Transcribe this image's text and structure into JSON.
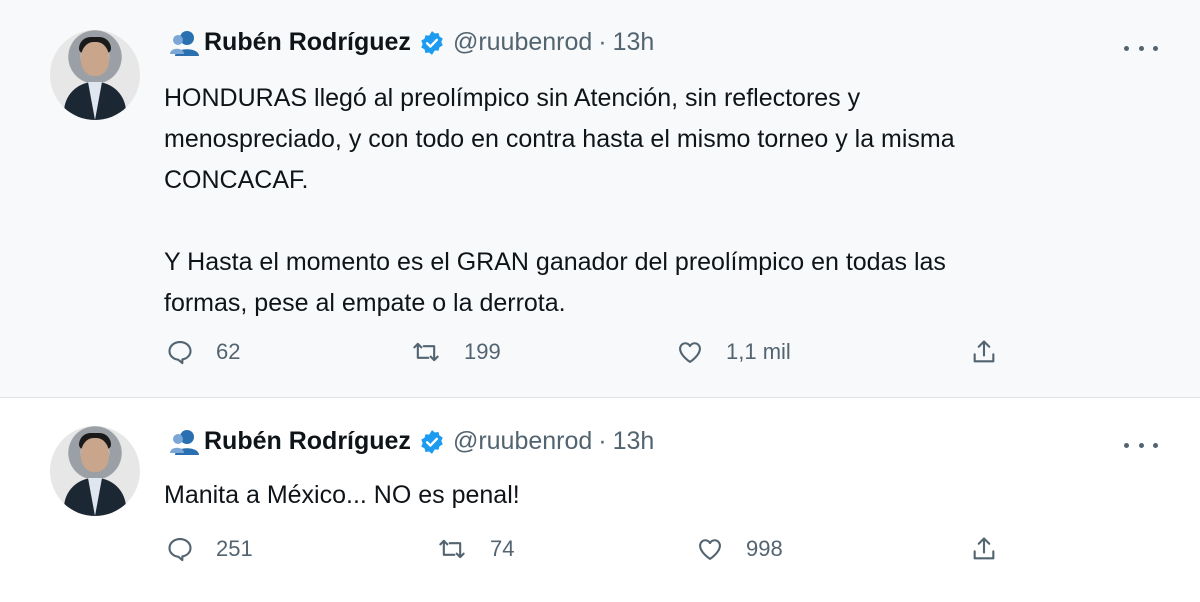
{
  "tweets": [
    {
      "author": {
        "name": "Rubén Rodríguez",
        "handle": "@ruubenrod",
        "separator": "·",
        "time": "13h"
      },
      "text_lines": [
        "HONDURAS llegó al preolímpico sin Atención, sin reflectores y",
        "menospreciado, y con todo en contra hasta el mismo torneo y la misma",
        "CONCACAF.",
        "",
        "Y Hasta el momento es el GRAN ganador del preolímpico en todas las",
        "formas, pese al empate o la derrota."
      ],
      "replies": "62",
      "retweets": "199",
      "likes": "1,1 mil"
    },
    {
      "author": {
        "name": "Rubén Rodríguez",
        "handle": "@ruubenrod",
        "separator": "·",
        "time": "13h"
      },
      "text_lines": [
        "Manita a México... NO es penal!"
      ],
      "replies": "251",
      "retweets": "74",
      "likes": "998"
    }
  ],
  "icons": {
    "user": "user-icon",
    "verified": "verified-badge-icon",
    "more": "more-options-icon",
    "reply": "reply-icon",
    "retweet": "retweet-icon",
    "like": "like-heart-icon",
    "share": "share-icon"
  },
  "colors": {
    "verified": "#1d9bf0",
    "secondary_text": "#536471",
    "primary_text": "#0f1419",
    "highlight_bg": "#f7f9fa"
  }
}
